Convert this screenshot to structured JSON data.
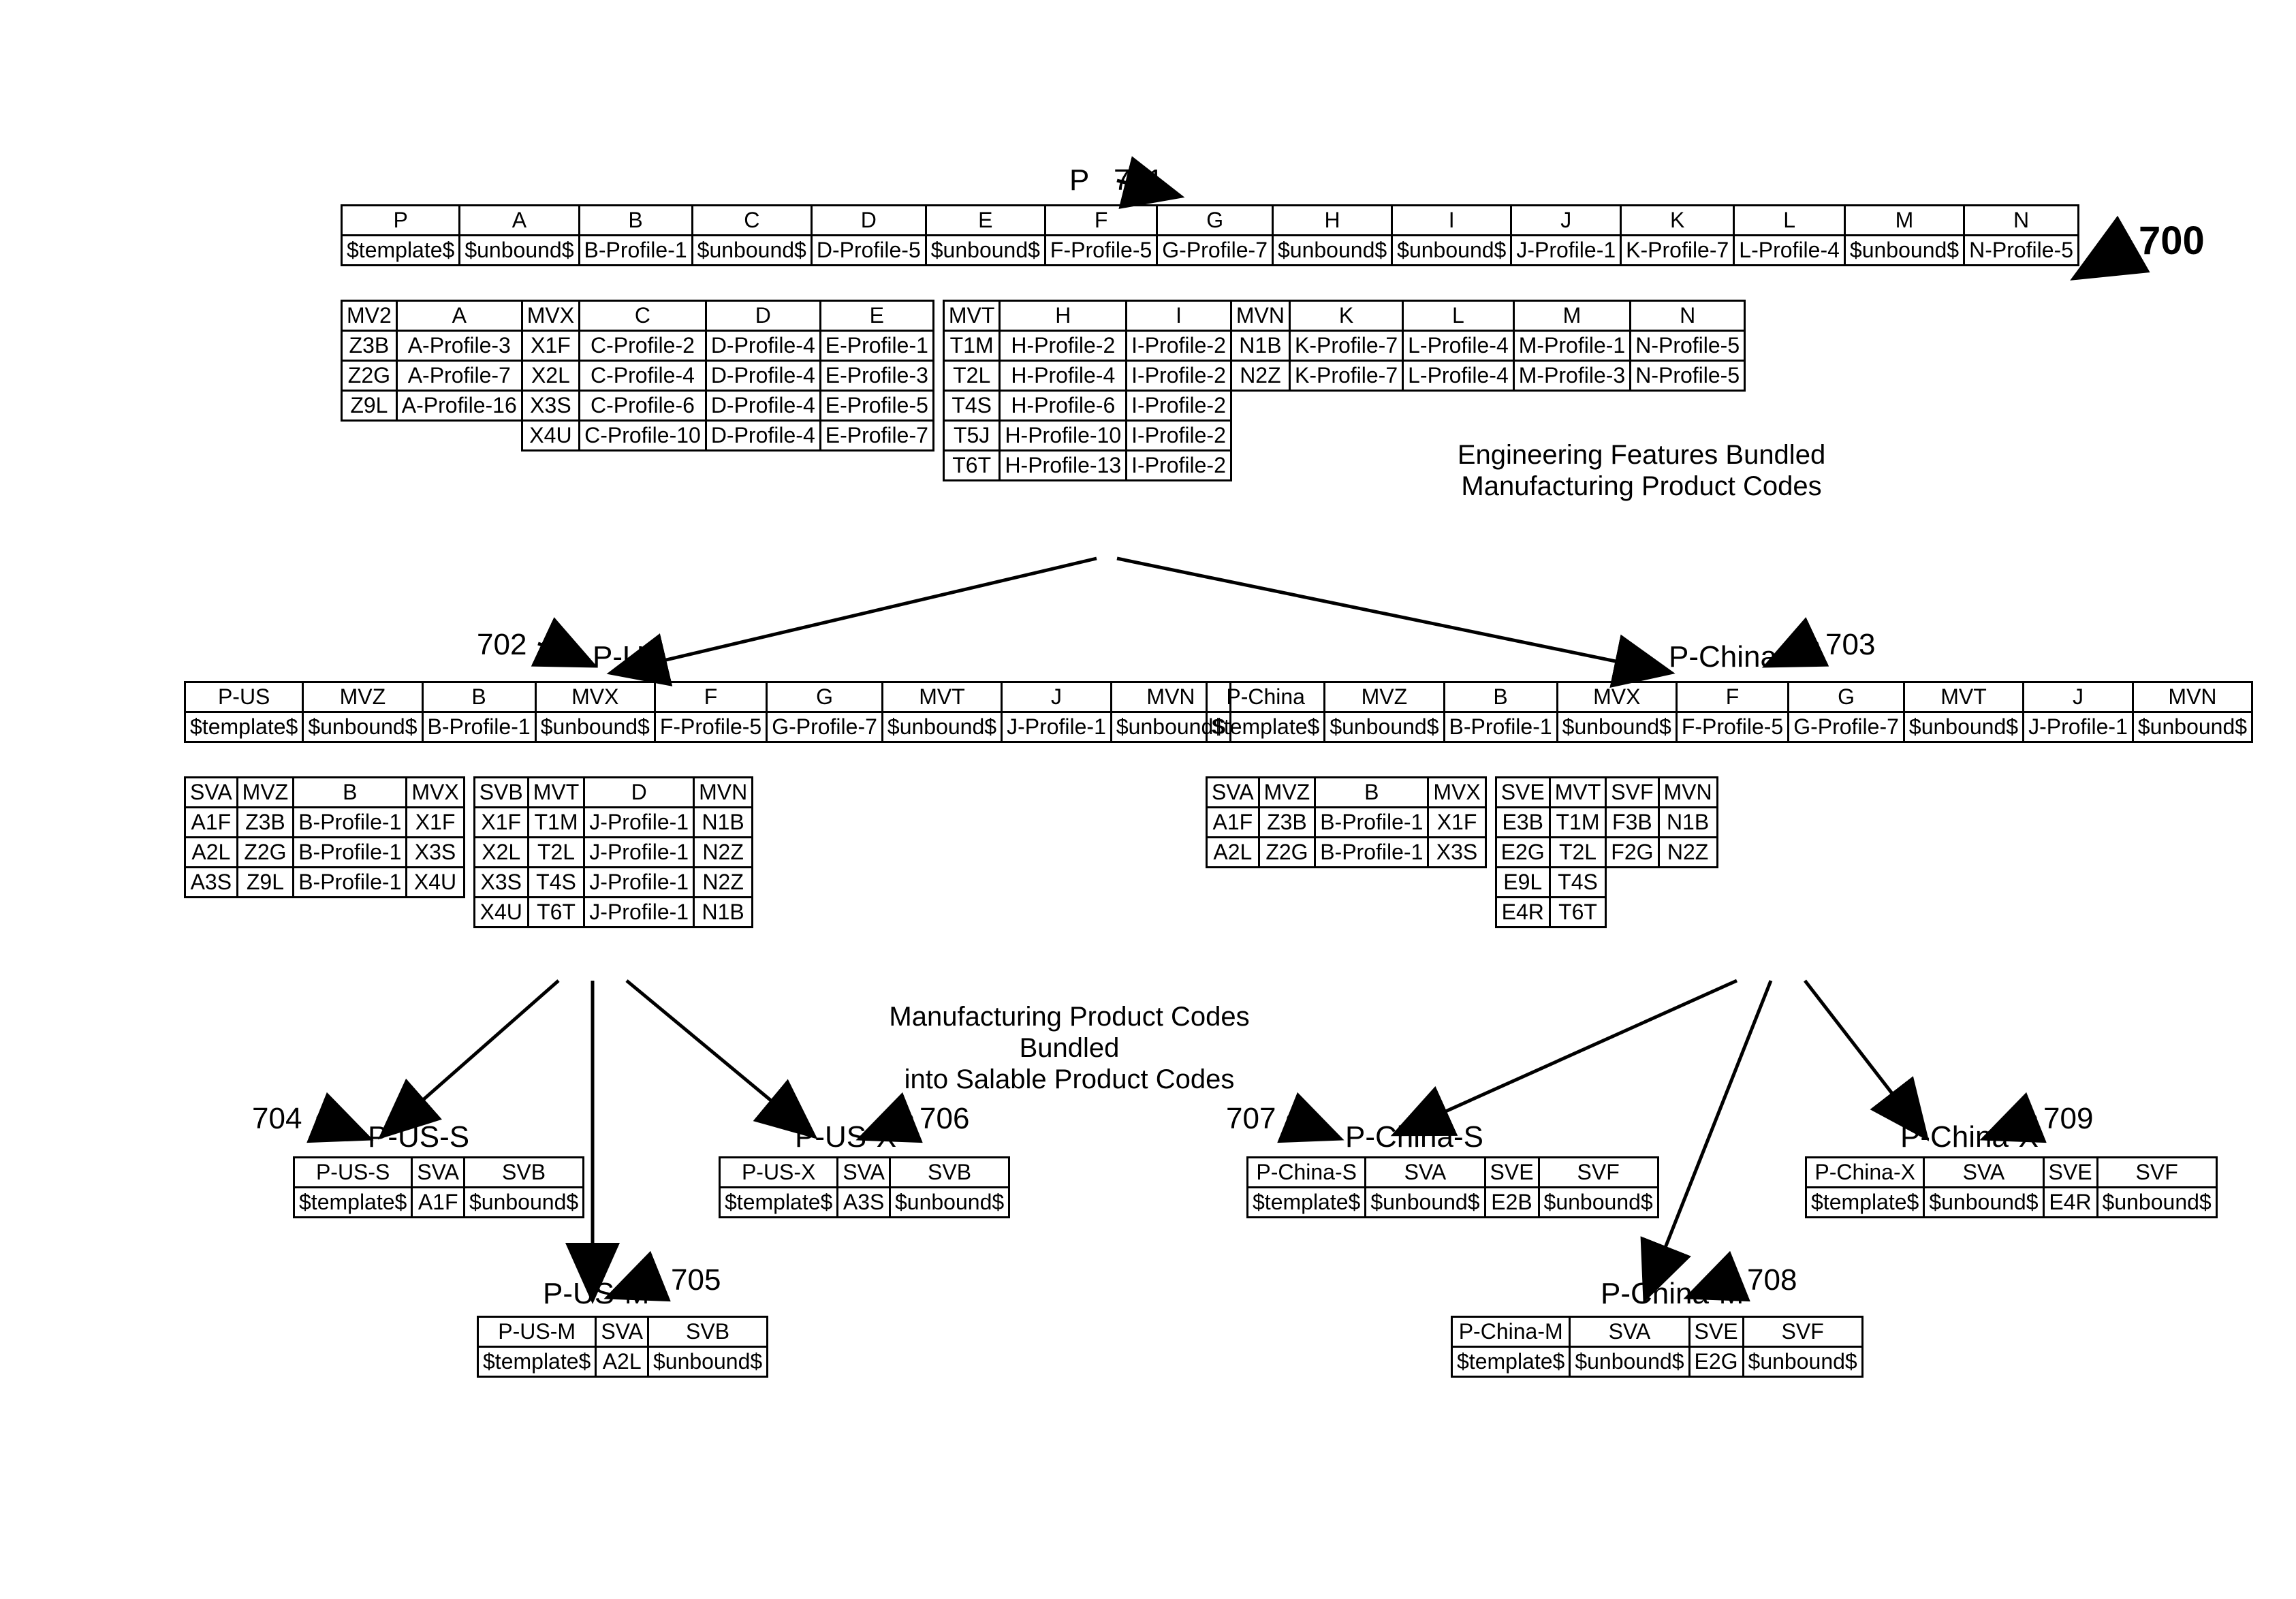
{
  "figureLabel": "700",
  "topLabel": {
    "ref": "701",
    "name": "P"
  },
  "notes": {
    "top": "Engineering Features Bundled\nManufacturing Product Codes",
    "mid": "Manufacturing Product Codes Bundled\ninto Salable Product Codes"
  },
  "nodes": {
    "n702": {
      "ref": "702",
      "name": "P-US"
    },
    "n703": {
      "ref": "703",
      "name": "P-China"
    },
    "n704": {
      "ref": "704",
      "name": "P-US-S"
    },
    "n705": {
      "ref": "705",
      "name": "P-US-M"
    },
    "n706": {
      "ref": "706",
      "name": "P-US-X"
    },
    "n707": {
      "ref": "707",
      "name": "P-China-S"
    },
    "n708": {
      "ref": "708",
      "name": "P-China-M"
    },
    "n709": {
      "ref": "709",
      "name": "P-China-X"
    }
  },
  "t701a": {
    "r0": [
      "P",
      "A",
      "B",
      "C",
      "D",
      "E",
      "F",
      "G",
      "H",
      "I",
      "J",
      "K",
      "L",
      "M",
      "N"
    ],
    "r1": [
      "$template$",
      "$unbound$",
      "B-Profile-1",
      "$unbound$",
      "D-Profile-5",
      "$unbound$",
      "F-Profile-5",
      "G-Profile-7",
      "$unbound$",
      "$unbound$",
      "J-Profile-1",
      "K-Profile-7",
      "L-Profile-4",
      "$unbound$",
      "N-Profile-5"
    ]
  },
  "t701b": {
    "r0": [
      "MV2",
      "A",
      "MVX",
      "C",
      "D",
      "E",
      "",
      "MVT",
      "H",
      "I",
      "MVN",
      "K",
      "L",
      "M",
      "N"
    ],
    "r1": [
      "Z3B",
      "A-Profile-3",
      "X1F",
      "C-Profile-2",
      "D-Profile-4",
      "E-Profile-1",
      "",
      "T1M",
      "H-Profile-2",
      "I-Profile-2",
      "N1B",
      "K-Profile-7",
      "L-Profile-4",
      "M-Profile-1",
      "N-Profile-5"
    ],
    "r2": [
      "Z2G",
      "A-Profile-7",
      "X2L",
      "C-Profile-4",
      "D-Profile-4",
      "E-Profile-3",
      "",
      "T2L",
      "H-Profile-4",
      "I-Profile-2",
      "N2Z",
      "K-Profile-7",
      "L-Profile-4",
      "M-Profile-3",
      "N-Profile-5"
    ],
    "r3": [
      "Z9L",
      "A-Profile-16",
      "X3S",
      "C-Profile-6",
      "D-Profile-4",
      "E-Profile-5",
      "",
      "T4S",
      "H-Profile-6",
      "I-Profile-2",
      "",
      "",
      "",
      "",
      ""
    ],
    "r4": [
      "",
      "",
      "X4U",
      "C-Profile-10",
      "D-Profile-4",
      "E-Profile-7",
      "",
      "T5J",
      "H-Profile-10",
      "I-Profile-2",
      "",
      "",
      "",
      "",
      ""
    ],
    "r5": [
      "",
      "",
      "",
      "",
      "",
      "",
      "",
      "T6T",
      "H-Profile-13",
      "I-Profile-2",
      "",
      "",
      "",
      "",
      ""
    ]
  },
  "t702a": {
    "r0": [
      "P-US",
      "MVZ",
      "B",
      "MVX",
      "F",
      "G",
      "MVT",
      "J",
      "MVN"
    ],
    "r1": [
      "$template$",
      "$unbound$",
      "B-Profile-1",
      "$unbound$",
      "F-Profile-5",
      "G-Profile-7",
      "$unbound$",
      "J-Profile-1",
      "$unbound$"
    ]
  },
  "t702b": {
    "r0": [
      "SVA",
      "MVZ",
      "B",
      "MVX",
      "",
      "SVB",
      "MVT",
      "D",
      "MVN"
    ],
    "r1": [
      "A1F",
      "Z3B",
      "B-Profile-1",
      "X1F",
      "",
      "X1F",
      "T1M",
      "J-Profile-1",
      "N1B"
    ],
    "r2": [
      "A2L",
      "Z2G",
      "B-Profile-1",
      "X3S",
      "",
      "X2L",
      "T2L",
      "J-Profile-1",
      "N2Z"
    ],
    "r3": [
      "A3S",
      "Z9L",
      "B-Profile-1",
      "X4U",
      "",
      "X3S",
      "T4S",
      "J-Profile-1",
      "N2Z"
    ],
    "r4": [
      "",
      "",
      "",
      "",
      "",
      "X4U",
      "T6T",
      "J-Profile-1",
      "N1B"
    ]
  },
  "t703a": {
    "r0": [
      "P-China",
      "MVZ",
      "B",
      "MVX",
      "F",
      "G",
      "MVT",
      "J",
      "MVN"
    ],
    "r1": [
      "$template$",
      "$unbound$",
      "B-Profile-1",
      "$unbound$",
      "F-Profile-5",
      "G-Profile-7",
      "$unbound$",
      "J-Profile-1",
      "$unbound$"
    ]
  },
  "t703b": {
    "r0": [
      "SVA",
      "MVZ",
      "B",
      "MVX",
      "",
      "SVE",
      "MVT",
      "SVF",
      "MVN"
    ],
    "r1": [
      "A1F",
      "Z3B",
      "B-Profile-1",
      "X1F",
      "",
      "E3B",
      "T1M",
      "F3B",
      "N1B"
    ],
    "r2": [
      "A2L",
      "Z2G",
      "B-Profile-1",
      "X3S",
      "",
      "E2G",
      "T2L",
      "F2G",
      "N2Z"
    ],
    "r3": [
      "",
      "",
      "",
      "",
      "",
      "E9L",
      "T4S",
      "",
      ""
    ],
    "r4": [
      "",
      "",
      "",
      "",
      "",
      "E4R",
      "T6T",
      "",
      ""
    ]
  },
  "t704": {
    "r0": [
      "P-US-S",
      "SVA",
      "SVB"
    ],
    "r1": [
      "$template$",
      "A1F",
      "$unbound$"
    ]
  },
  "t705": {
    "r0": [
      "P-US-M",
      "SVA",
      "SVB"
    ],
    "r1": [
      "$template$",
      "A2L",
      "$unbound$"
    ]
  },
  "t706": {
    "r0": [
      "P-US-X",
      "SVA",
      "SVB"
    ],
    "r1": [
      "$template$",
      "A3S",
      "$unbound$"
    ]
  },
  "t707": {
    "r0": [
      "P-China-S",
      "SVA",
      "SVE",
      "SVF"
    ],
    "r1": [
      "$template$",
      "$unbound$",
      "E2B",
      "$unbound$"
    ]
  },
  "t708": {
    "r0": [
      "P-China-M",
      "SVA",
      "SVE",
      "SVF"
    ],
    "r1": [
      "$template$",
      "$unbound$",
      "E2G",
      "$unbound$"
    ]
  },
  "t709": {
    "r0": [
      "P-China-X",
      "SVA",
      "SVE",
      "SVF"
    ],
    "r1": [
      "$template$",
      "$unbound$",
      "E4R",
      "$unbound$"
    ]
  }
}
